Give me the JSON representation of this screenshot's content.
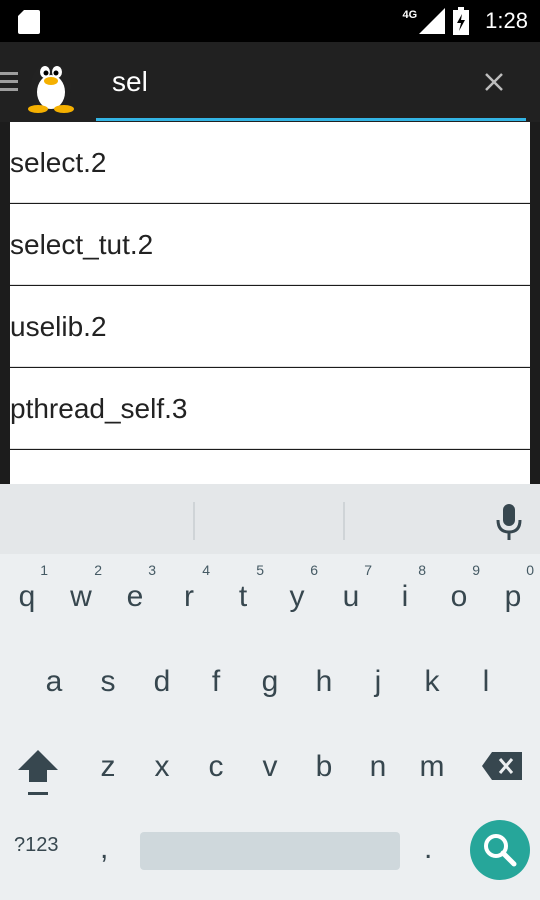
{
  "status_bar": {
    "network_label": "4G",
    "time": "1:28"
  },
  "search": {
    "query": "sel"
  },
  "results": [
    "select.2",
    "select_tut.2",
    "uselib.2",
    "pthread_self.3"
  ],
  "keyboard": {
    "row1": [
      {
        "key": "q",
        "hint": "1"
      },
      {
        "key": "w",
        "hint": "2"
      },
      {
        "key": "e",
        "hint": "3"
      },
      {
        "key": "r",
        "hint": "4"
      },
      {
        "key": "t",
        "hint": "5"
      },
      {
        "key": "y",
        "hint": "6"
      },
      {
        "key": "u",
        "hint": "7"
      },
      {
        "key": "i",
        "hint": "8"
      },
      {
        "key": "o",
        "hint": "9"
      },
      {
        "key": "p",
        "hint": "0"
      }
    ],
    "row2": [
      "a",
      "s",
      "d",
      "f",
      "g",
      "h",
      "j",
      "k",
      "l"
    ],
    "row3": [
      "z",
      "x",
      "c",
      "v",
      "b",
      "n",
      "m"
    ],
    "symbols_label": "?123",
    "comma": ",",
    "period": "."
  },
  "colors": {
    "accent": "#33b5e5",
    "search_key": "#26a69a",
    "actionbar": "#212121"
  },
  "icons": [
    "sd-card-icon",
    "signal-icon",
    "battery-icon",
    "menu-icon",
    "tux-logo-icon",
    "close-icon",
    "mic-icon",
    "shift-icon",
    "backspace-icon",
    "search-icon"
  ]
}
